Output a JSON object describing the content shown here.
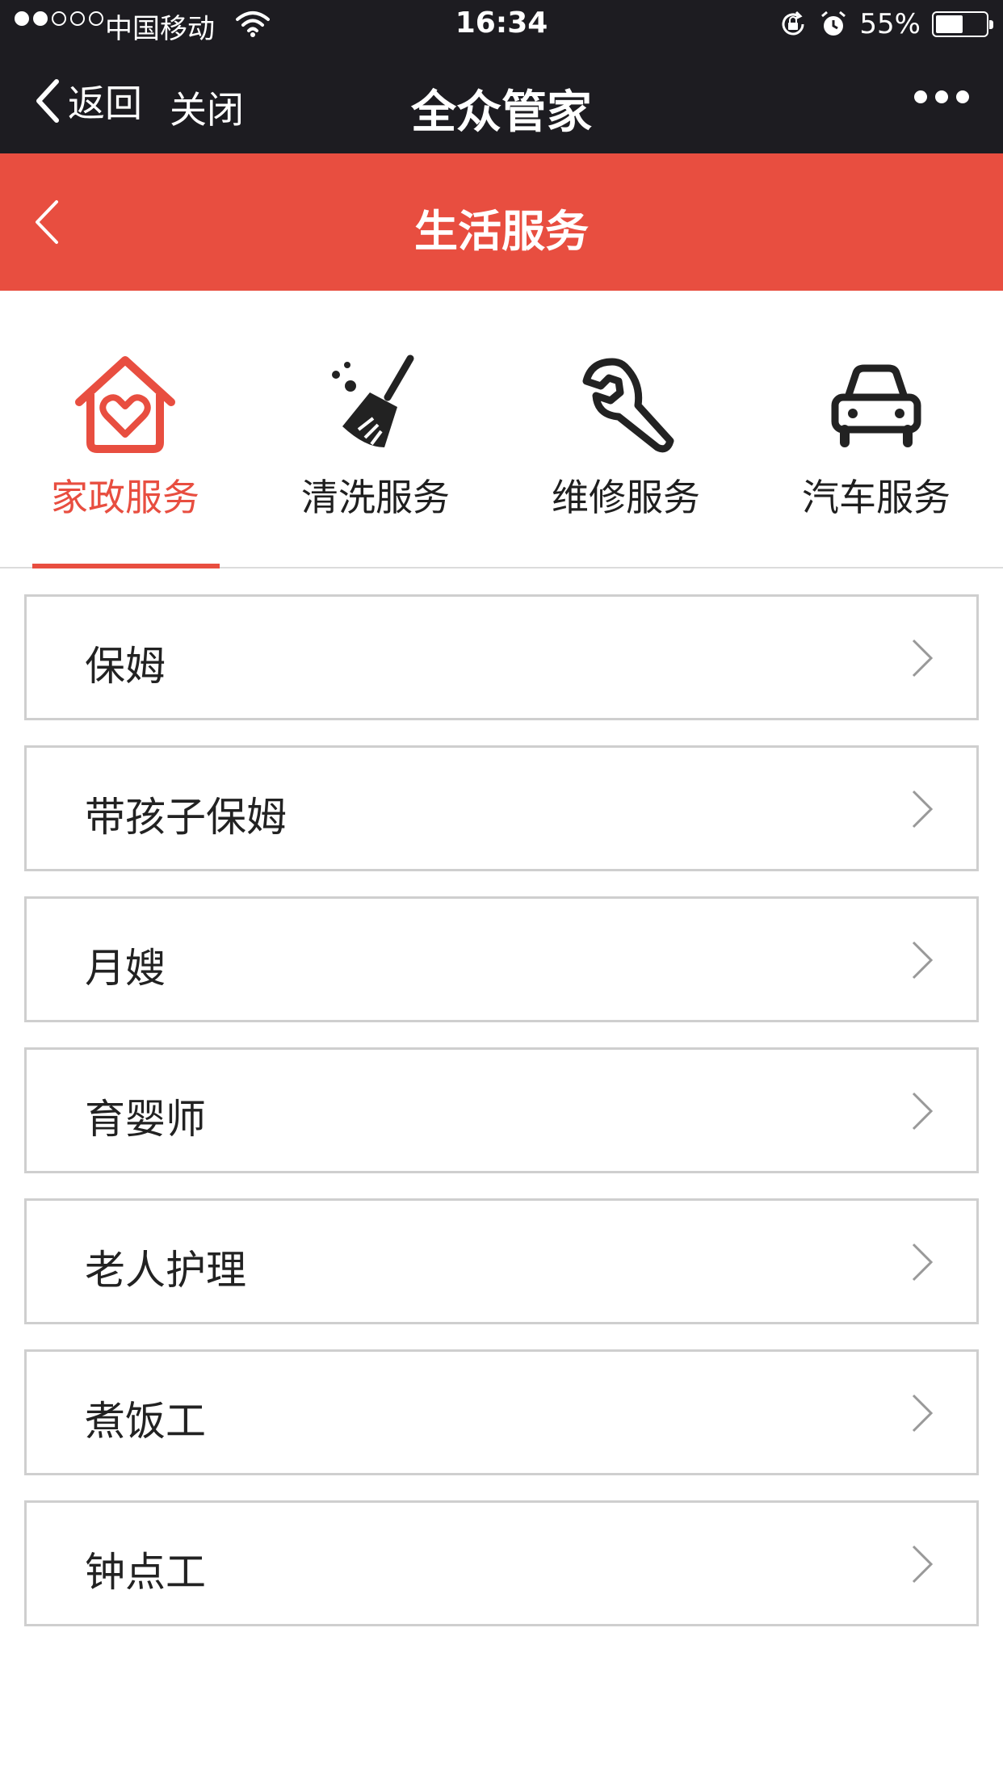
{
  "status_bar": {
    "carrier": "中国移动",
    "time": "16:34",
    "battery_percent": "55%",
    "battery_level": 0.55,
    "signal_bars": 2
  },
  "wechat_nav": {
    "back_label": "返回",
    "close_label": "关闭",
    "title": "全众管家"
  },
  "header": {
    "title": "生活服务"
  },
  "categories": [
    {
      "label": "家政服务",
      "icon": "home-heart-icon",
      "active": true
    },
    {
      "label": "清洗服务",
      "icon": "broom-icon",
      "active": false
    },
    {
      "label": "维修服务",
      "icon": "wrench-icon",
      "active": false
    },
    {
      "label": "汽车服务",
      "icon": "car-icon",
      "active": false
    }
  ],
  "services": [
    {
      "label": "保姆"
    },
    {
      "label": "带孩子保姆"
    },
    {
      "label": "月嫂"
    },
    {
      "label": "育婴师"
    },
    {
      "label": "老人护理"
    },
    {
      "label": "煮饭工"
    },
    {
      "label": "钟点工"
    }
  ],
  "colors": {
    "accent": "#e84e40",
    "nav_bg": "#1d1c21",
    "row_border": "#cfcfcf"
  }
}
